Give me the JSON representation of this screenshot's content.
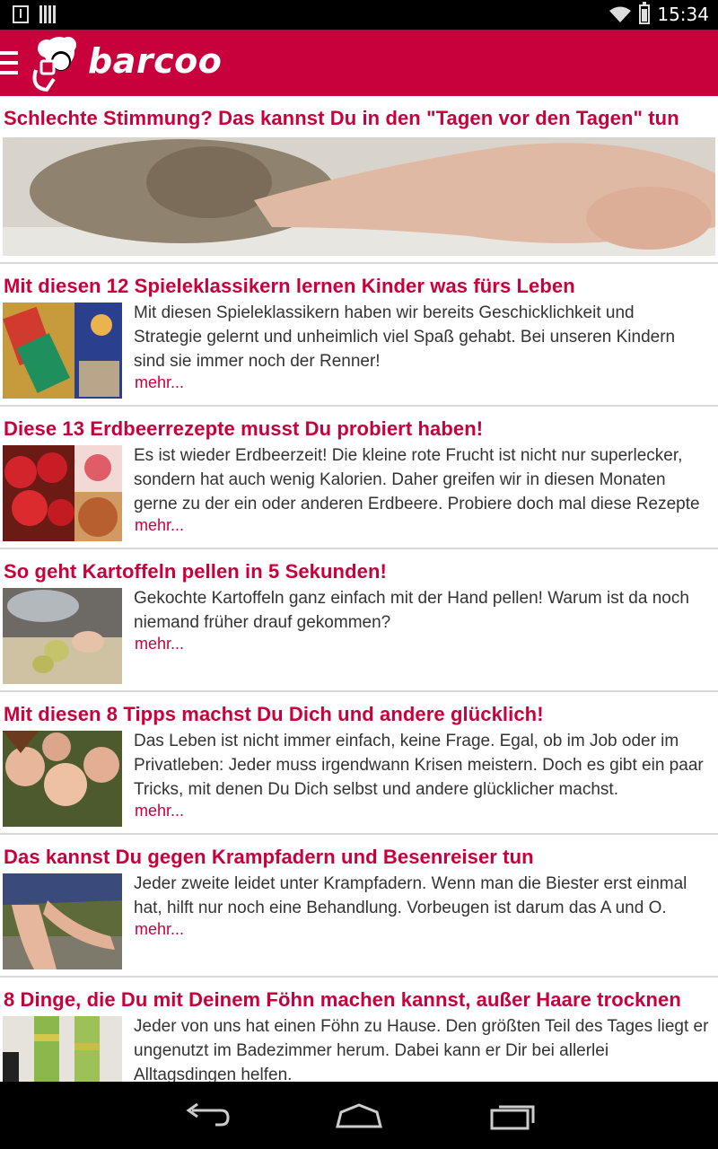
{
  "status_bar": {
    "time": "15:34"
  },
  "app_bar": {
    "brand": "barcoo"
  },
  "articles": [
    {
      "title": "Schlechte Stimmung? Das kannst Du in den \"Tagen vor den Tagen\" tun"
    },
    {
      "title": "Mit diesen 12 Spieleklassikern lernen Kinder was fürs Leben",
      "lines": [
        "Mit diesen Spieleklassikern haben wir bereits Geschicklichkeit und",
        "Strategie gelernt und unheimlich viel Spaß gehabt. Bei unseren Kindern",
        "sind sie immer noch der Renner!"
      ],
      "more": "mehr..."
    },
    {
      "title": "Diese 13 Erdbeerrezepte musst Du probiert haben!",
      "lines": [
        "Es ist wieder Erdbeerzeit! Die kleine rote Frucht ist nicht nur superlecker,",
        "sondern hat auch wenig Kalorien. Daher greifen wir in diesen Monaten",
        "gerne zu der ein oder anderen Erdbeere. Probiere doch mal diese Rezepte"
      ],
      "more": "mehr..."
    },
    {
      "title": "So geht Kartoffeln pellen in 5 Sekunden!",
      "lines": [
        "Gekochte Kartoffeln ganz einfach mit der Hand pellen! Warum ist da noch",
        "niemand früher drauf gekommen?"
      ],
      "more": "mehr..."
    },
    {
      "title": "Mit diesen 8 Tipps machst Du Dich und andere glücklich!",
      "lines": [
        "Das Leben ist nicht immer einfach, keine Frage. Egal, ob im Job oder im",
        "Privatleben: Jeder muss irgendwann Krisen meistern. Doch es gibt ein paar",
        "Tricks, mit denen Du Dich selbst und andere glücklicher machst."
      ],
      "more": "mehr..."
    },
    {
      "title": "Das kannst Du gegen Krampfadern und Besenreiser tun",
      "lines": [
        "Jeder zweite leidet unter Krampfadern. Wenn man die Biester erst einmal",
        "hat, hilft nur noch eine Behandlung. Vorbeugen ist darum das A und O."
      ],
      "more": "mehr..."
    },
    {
      "title": "8 Dinge, die Du mit Deinem Föhn machen kannst, außer Haare trocknen",
      "lines": [
        "Jeder von uns hat einen Föhn zu Hause. Den größten Teil des Tages liegt er",
        "ungenutzt im Badezimmer herum. Dabei kann er Dir bei allerlei",
        "Alltagsdingen helfen."
      ]
    }
  ],
  "colors": {
    "brand": "#c8003c",
    "text": "#333333",
    "divider": "#d9d9d9"
  }
}
